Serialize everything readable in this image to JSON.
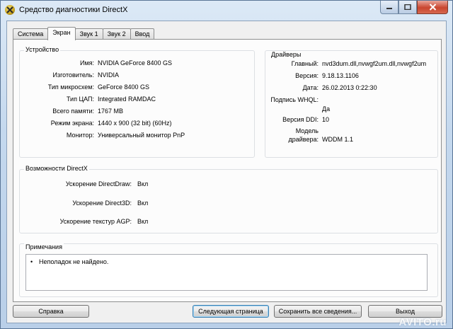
{
  "window": {
    "title": "Средство диагностики DirectX"
  },
  "tabs": [
    {
      "label": "Система"
    },
    {
      "label": "Экран"
    },
    {
      "label": "Звук 1"
    },
    {
      "label": "Звук 2"
    },
    {
      "label": "Ввод"
    }
  ],
  "active_tab": "Экран",
  "device": {
    "title": "Устройство",
    "rows": [
      {
        "label": "Имя:",
        "value": "NVIDIA GeForce 8400 GS"
      },
      {
        "label": "Изготовитель:",
        "value": "NVIDIA"
      },
      {
        "label": "Тип микросхем:",
        "value": "GeForce 8400 GS"
      },
      {
        "label": "Тип ЦАП:",
        "value": "Integrated RAMDAC"
      },
      {
        "label": "Всего памяти:",
        "value": "1767 MB"
      },
      {
        "label": "Режим экрана:",
        "value": "1440 x 900 (32 bit) (60Hz)"
      },
      {
        "label": "Монитор:",
        "value": "Универсальный монитор PnP"
      }
    ]
  },
  "drivers": {
    "title": "Драйверы",
    "rows": [
      {
        "label": "Главный:",
        "value": "nvd3dum.dll,nvwgf2um.dll,nvwgf2um"
      },
      {
        "label": "Версия:",
        "value": "9.18.13.1106"
      },
      {
        "label": "Дата:",
        "value": "26.02.2013 0:22:30"
      },
      {
        "label": "Подпись WHQL:",
        "value": "Да"
      },
      {
        "label": "Версия DDI:",
        "value": "10"
      },
      {
        "label_line1": "Модель",
        "label_line2": "драйвера:",
        "value": "WDDM 1.1"
      }
    ]
  },
  "features": {
    "title": "Возможности DirectX",
    "rows": [
      {
        "label": "Ускорение DirectDraw:",
        "value": "Вкл"
      },
      {
        "label": "Ускорение Direct3D:",
        "value": "Вкл"
      },
      {
        "label": "Ускорение текстур AGP:",
        "value": "Вкл"
      }
    ]
  },
  "notes": {
    "title": "Примечания",
    "items": [
      "Неполадок не найдено."
    ]
  },
  "buttons": {
    "help": "Справка",
    "next_page": "Следующая страница",
    "save_all": "Сохранить все сведения...",
    "exit": "Выход"
  },
  "watermark": "AVITO.ru"
}
